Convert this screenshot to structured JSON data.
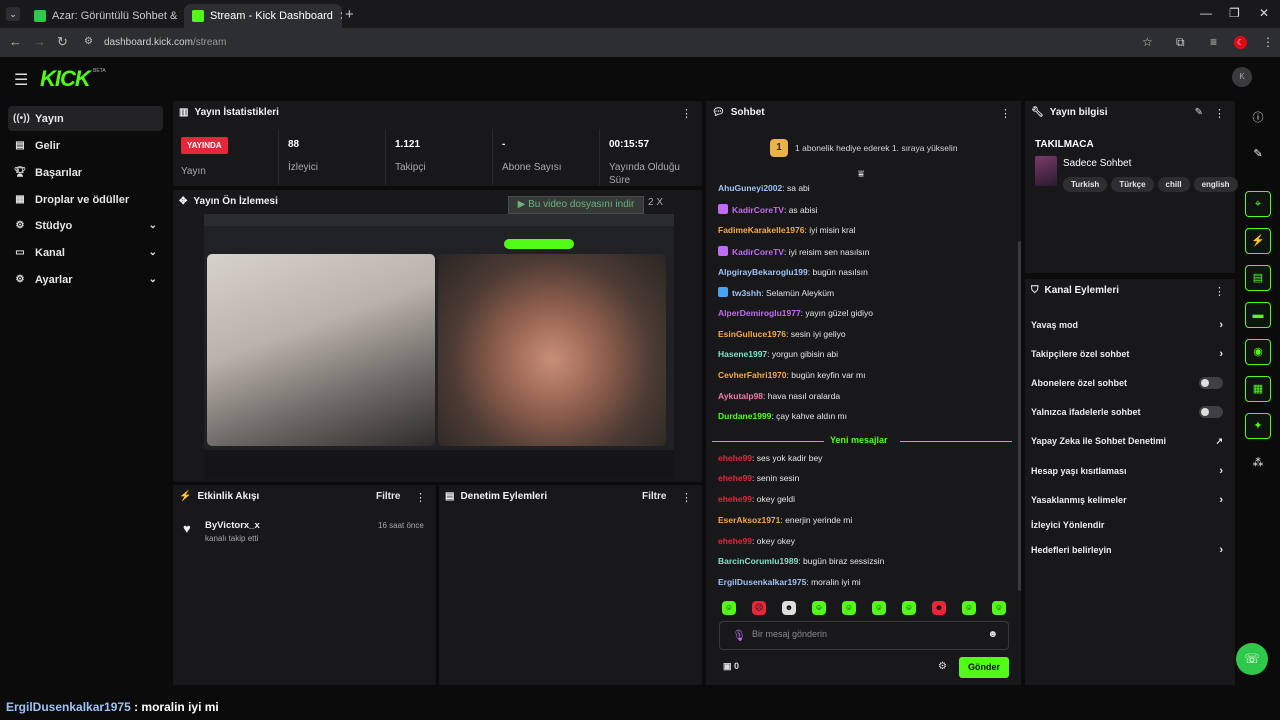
{
  "browser": {
    "tabs": [
      {
        "title": "Azar: Görüntülü Sohbet & Y",
        "active": false
      },
      {
        "title": "Stream - Kick Dashboard",
        "active": true
      }
    ],
    "url_host": "dashboard.kick.com",
    "url_path": "/stream"
  },
  "app": {
    "logo": "KICK",
    "beta": "BETA"
  },
  "sidebar": {
    "items": [
      {
        "label": "Yayın",
        "icon": "broadcast-icon"
      },
      {
        "label": "Gelir",
        "icon": "revenue-icon"
      },
      {
        "label": "Başarılar",
        "icon": "trophy-icon"
      },
      {
        "label": "Droplar ve ödüller",
        "icon": "drops-icon"
      },
      {
        "label": "Stüdyo",
        "icon": "studio-icon"
      },
      {
        "label": "Kanal",
        "icon": "channel-icon"
      },
      {
        "label": "Ayarlar",
        "icon": "settings-icon"
      }
    ]
  },
  "stats": {
    "title": "Yayın İstatistikleri",
    "live_badge": "YAYINDA",
    "live_label": "Yayın",
    "viewers": {
      "value": "88",
      "label": "İzleyici"
    },
    "followers": {
      "value": "1.121",
      "label": "Takipçi"
    },
    "subs": {
      "value": "-",
      "label": "Abone Sayısı"
    },
    "uptime": {
      "value": "00:15:57",
      "label": "Yayında Olduğu Süre"
    }
  },
  "preview": {
    "title": "Yayın Ön İzlemesi",
    "download_bar": "▶ Bu video dosyasını indir",
    "download_bar_extra": "2 X"
  },
  "activity": {
    "title": "Etkinlik Akışı",
    "filter": "Filtre",
    "events": [
      {
        "user": "ByVictorx_x",
        "text": "kanalı takip etti",
        "time": "16 saat önce"
      }
    ]
  },
  "moderation": {
    "title": "Denetim Eylemleri",
    "filter": "Filtre"
  },
  "chat": {
    "title": "Sohbet",
    "gift_rank": "1",
    "gift_text": "1 abonelik hediye ederek 1. sıraya yükselin",
    "new_messages": "Yeni mesajlar",
    "messages": [
      {
        "user": "AhuGuneyi2002",
        "color": "#9ec2f5",
        "text": "sa abi",
        "badge": ""
      },
      {
        "user": "KadirCoreTV",
        "color": "#c06cf0",
        "text": "as abisi",
        "badge": "mic"
      },
      {
        "user": "FadimeKarakelle1976",
        "color": "#f5a94a",
        "text": "iyi misin kral",
        "badge": ""
      },
      {
        "user": "KadirCoreTV",
        "color": "#c06cf0",
        "text": "iyi reisim sen nasılsın",
        "badge": "mic"
      },
      {
        "user": "AlpgirayBekaroglu199",
        "color": "#9ec2f5",
        "text": "bugün nasılsın",
        "badge": ""
      },
      {
        "user": "tw3shh",
        "color": "#9ec2f5",
        "text": "Selamün Aleyküm",
        "badge": "img"
      },
      {
        "user": "AlperDemiroglu1977",
        "color": "#c06cf0",
        "text": "yayın güzel gidiyo",
        "badge": ""
      },
      {
        "user": "EsinGulluce1976",
        "color": "#f5a94a",
        "text": "sesin iyi geliyo",
        "badge": ""
      },
      {
        "user": "Hasene1997",
        "color": "#7fe3c7",
        "text": "yorgun gibisin abi",
        "badge": ""
      },
      {
        "user": "CevherFahri1970",
        "color": "#f5a94a",
        "text": "bugün keyfin var mı",
        "badge": ""
      },
      {
        "user": "Aykutalp98",
        "color": "#f07ca8",
        "text": "hava nasıl oralarda",
        "badge": ""
      },
      {
        "user": "Durdane1999",
        "color": "#53fc18",
        "text": "çay kahve aldın mı",
        "badge": ""
      },
      {
        "user": "ehehe99",
        "color": "#e5263b",
        "text": "ses yok kadir bey",
        "badge": ""
      },
      {
        "user": "ehehe99",
        "color": "#e5263b",
        "text": "senin sesin",
        "badge": ""
      },
      {
        "user": "ehehe99",
        "color": "#e5263b",
        "text": "okey geldi",
        "badge": ""
      },
      {
        "user": "EserAksoz1971",
        "color": "#f5a94a",
        "text": "enerjin yerinde mi",
        "badge": ""
      },
      {
        "user": "ehehe99",
        "color": "#e5263b",
        "text": "okey okey",
        "badge": ""
      },
      {
        "user": "BarcinCorumlu1989",
        "color": "#7fe3c7",
        "text": "bugün biraz sessizsin",
        "badge": ""
      },
      {
        "user": "ErgilDusenkalkar1975",
        "color": "#9ec2f5",
        "text": "moralin iyi mi",
        "badge": ""
      }
    ],
    "input_placeholder": "Bir mesaj gönderin",
    "points": "0",
    "send_label": "Gönder"
  },
  "stream_info": {
    "title": "Yayın bilgisi",
    "stream_title": "TAKILMACA",
    "category": "Sadece Sohbet",
    "tags": [
      "Turkish",
      "Türkçe",
      "chill",
      "english"
    ]
  },
  "channel_actions": {
    "title": "Kanal Eylemleri",
    "items": [
      {
        "label": "Yavaş mod",
        "control": "chevron"
      },
      {
        "label": "Takipçilere özel sohbet",
        "control": "chevron"
      },
      {
        "label": "Abonelere özel sohbet",
        "control": "toggle"
      },
      {
        "label": "Yalnızca ifadelerle sohbet",
        "control": "toggle"
      },
      {
        "label": "Yapay Zeka ile Sohbet Denetimi",
        "control": "external"
      },
      {
        "label": "Hesap yaşı kısıtlaması",
        "control": "chevron"
      },
      {
        "label": "Yasaklanmış kelimeler",
        "control": "chevron"
      },
      {
        "label": "İzleyici Yönlendir",
        "control": "none"
      },
      {
        "label": "Hedefleri belirleyin",
        "control": "chevron"
      }
    ]
  },
  "overlay": {
    "user": "ErgilDusenkalkar1975",
    "text": " : moralin iyi mi"
  },
  "colors": {
    "accent": "#53fc18",
    "live": "#e5263b",
    "panel": "#18181b",
    "bg": "#0b0b0c"
  }
}
